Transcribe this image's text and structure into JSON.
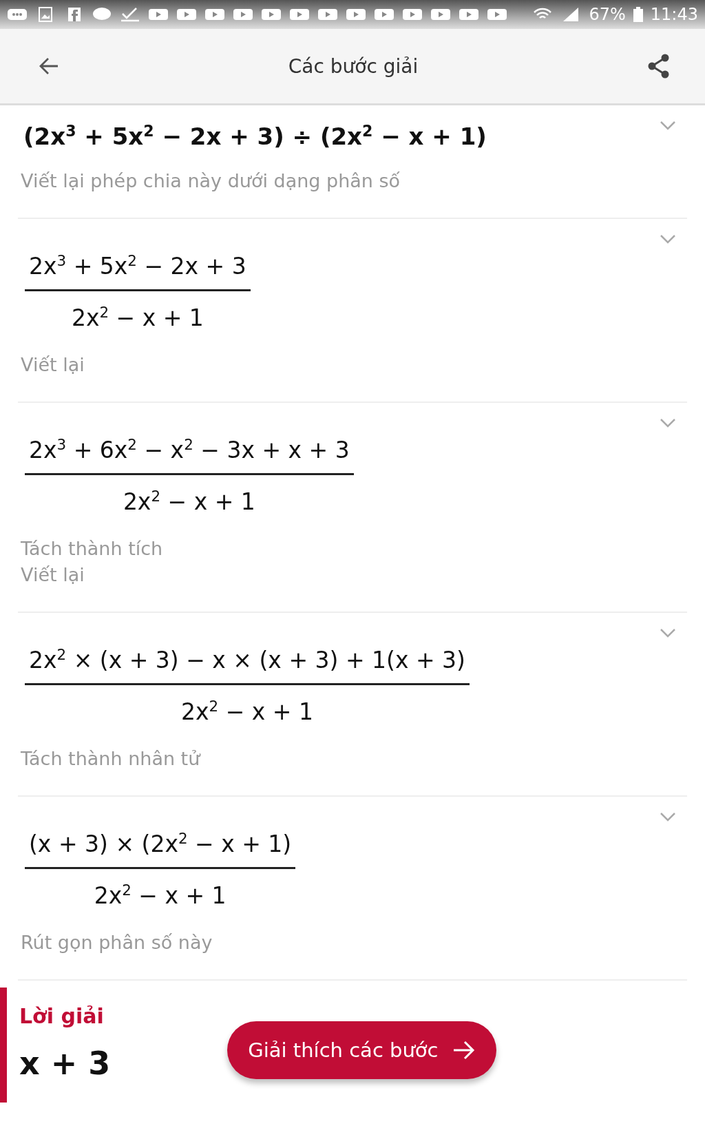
{
  "status_bar": {
    "battery": "67%",
    "time": "11:43"
  },
  "header": {
    "title": "Các bước giải"
  },
  "steps": [
    {
      "kind": "inline",
      "expression": "(2x$^{3}$ + 5x$^{2}$ − 2x + 3) ÷ (2x$^{2}$ − x + 1)",
      "notes": [
        "Viết lại phép chia này dưới dạng phân số"
      ]
    },
    {
      "kind": "fraction",
      "numerator": "2x$^{3}$ + 5x$^{2}$ − 2x + 3",
      "denominator": "2x$^{2}$ − x + 1",
      "notes": [
        "Viết lại"
      ]
    },
    {
      "kind": "fraction",
      "numerator": "2x$^{3}$ + 6x$^{2}$ − x$^{2}$ − 3x + x + 3",
      "denominator": "2x$^{2}$ − x + 1",
      "notes": [
        "Tách thành tích",
        "Viết lại"
      ]
    },
    {
      "kind": "fraction",
      "numerator": "2x$^{2}$ × (x + 3) − x × (x + 3) + 1(x + 3)",
      "denominator": "2x$^{2}$ − x + 1",
      "notes": [
        "Tách thành nhân tử"
      ]
    },
    {
      "kind": "fraction",
      "numerator": "(x + 3) × (2x$^{2}$ − x + 1)",
      "denominator": "2x$^{2}$ − x + 1",
      "notes": [
        "Rút gọn phân số này"
      ]
    }
  ],
  "solution": {
    "label": "Lời giải",
    "answer": "x + 3",
    "button": "Giải thích các bước"
  }
}
